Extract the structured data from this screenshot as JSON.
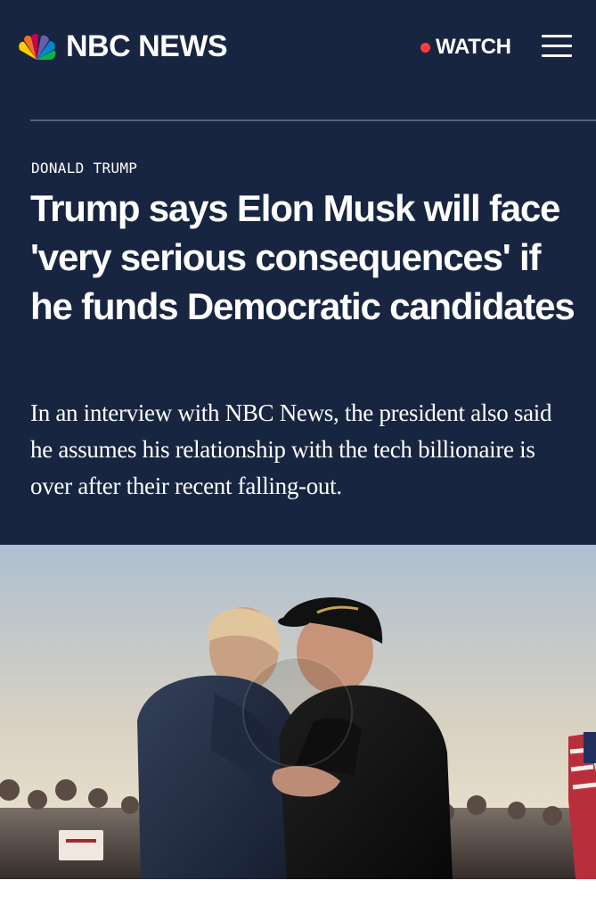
{
  "header": {
    "brand": "NBC NEWS",
    "watch_label": "WATCH",
    "icons": {
      "logo": "peacock-logo-icon",
      "live": "live-dot-icon",
      "menu": "hamburger-menu-icon"
    }
  },
  "article": {
    "category": "DONALD TRUMP",
    "headline": "Trump says Elon Musk will face 'very serious consequences' if he funds Democratic candidates",
    "dek": "In an interview with NBC News, the president also said he assumes his relationship with the tech billionaire is over after their recent falling-out."
  },
  "hero": {
    "media": "photo",
    "play_overlay": "play-circle-icon"
  },
  "colors": {
    "header_bg": "#182541",
    "live_dot": "#ff3b3b",
    "text_primary": "#ffffff",
    "divider": "#56607a"
  }
}
